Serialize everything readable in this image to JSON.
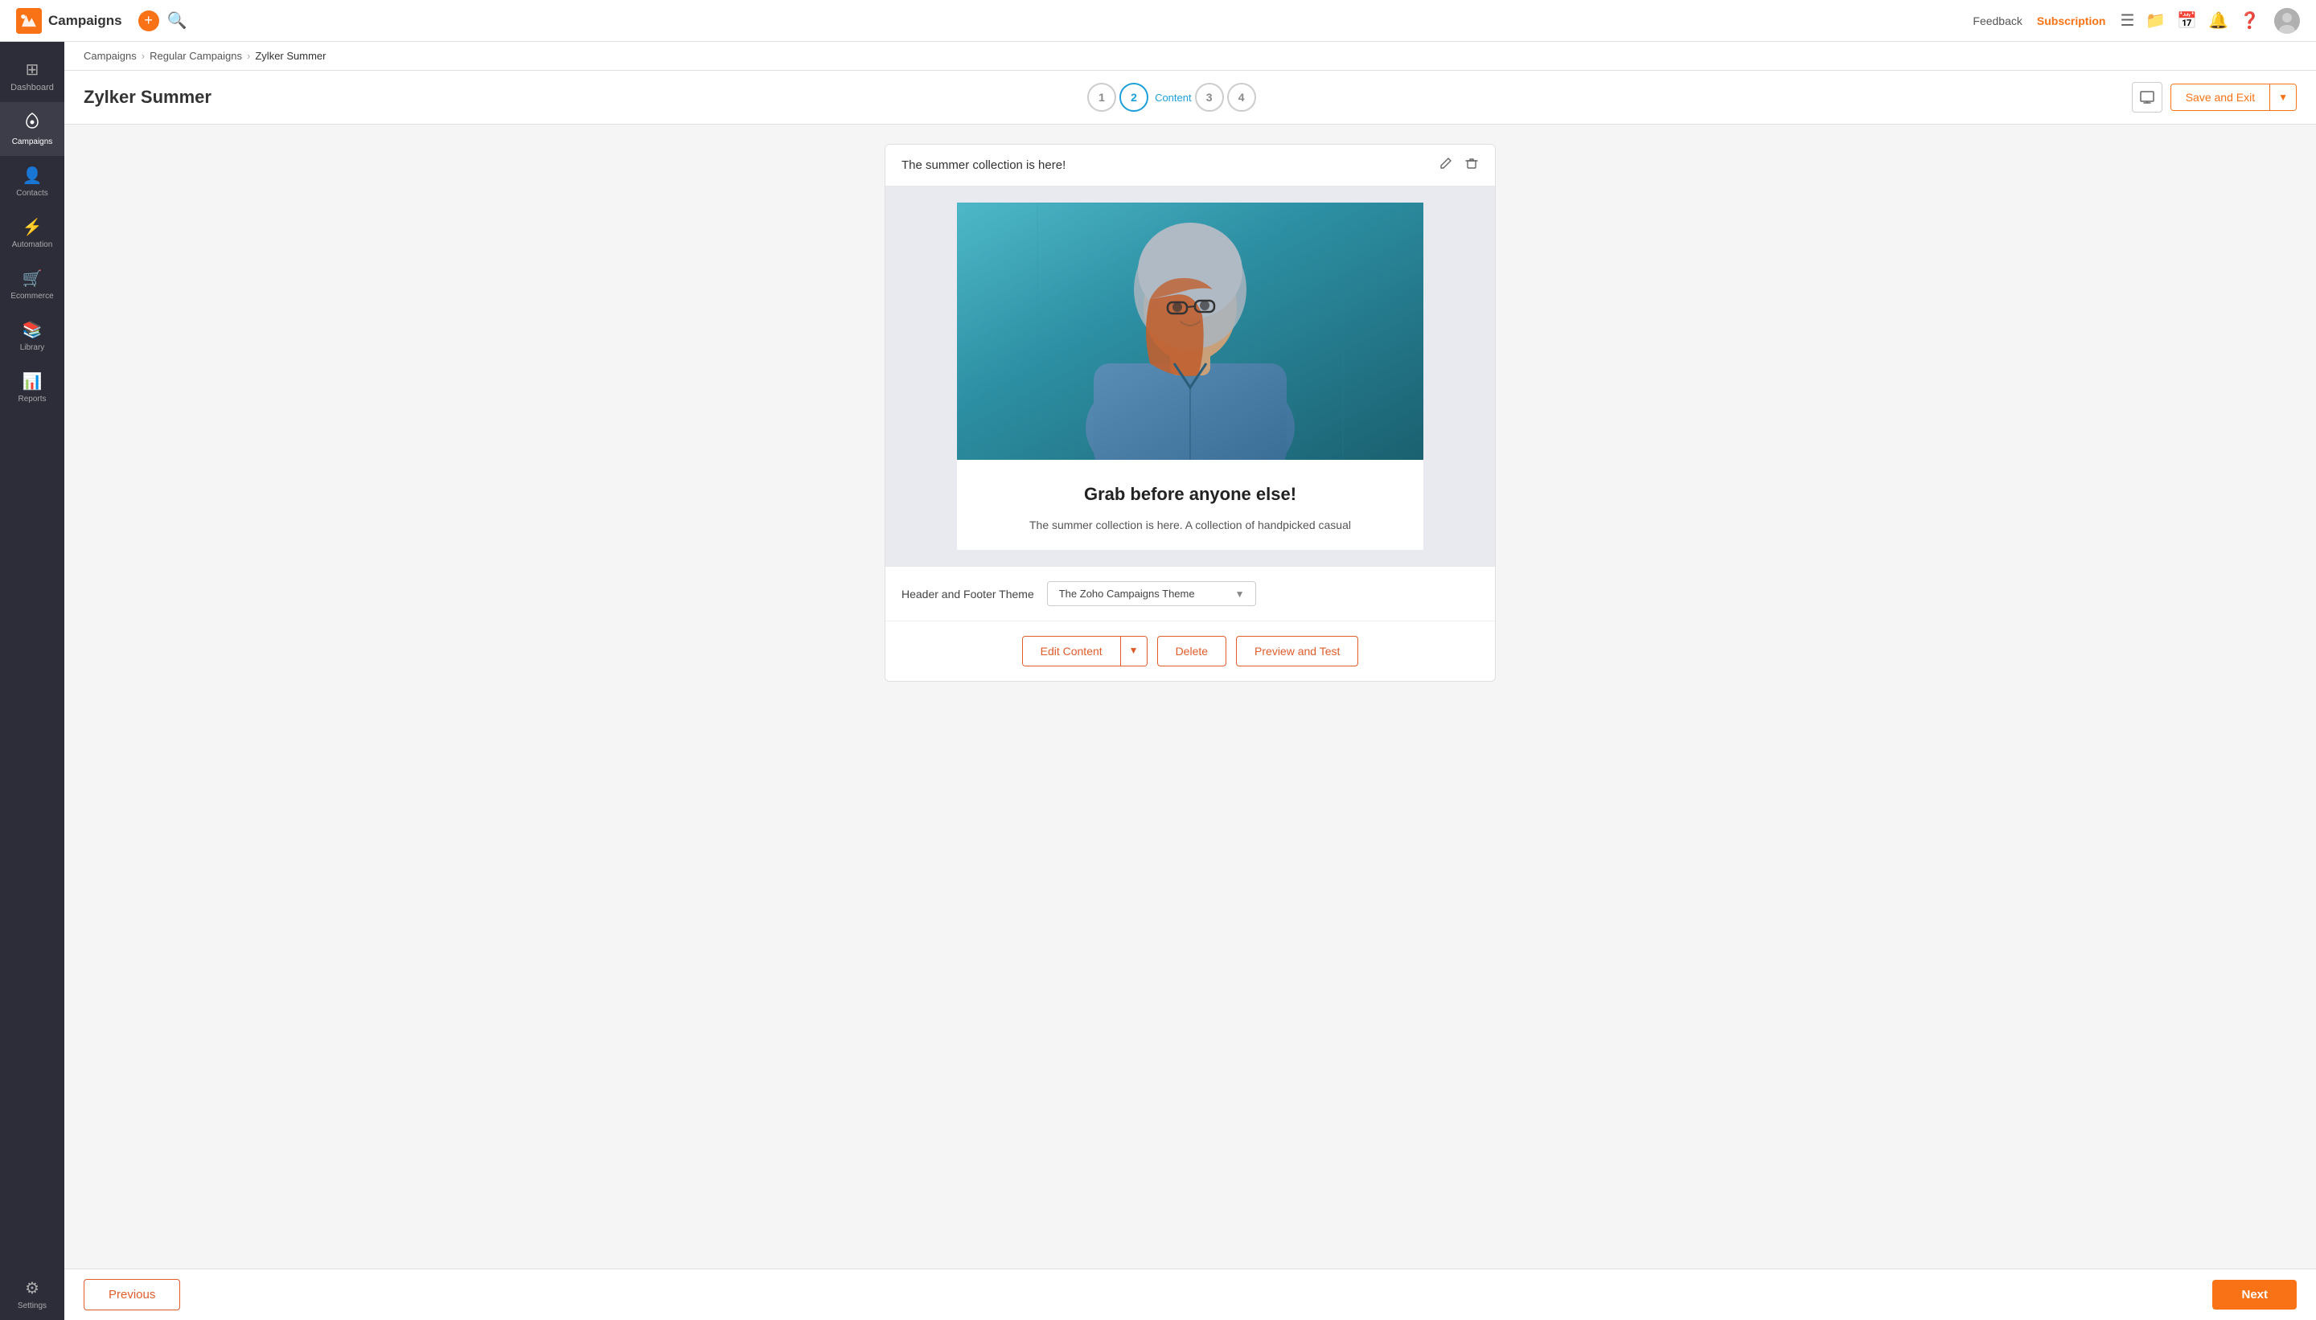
{
  "app": {
    "name": "Campaigns",
    "plus_label": "+",
    "search_label": "🔍"
  },
  "topnav": {
    "feedback": "Feedback",
    "subscription": "Subscription"
  },
  "sidebar": {
    "items": [
      {
        "id": "dashboard",
        "label": "Dashboard",
        "icon": "⊞"
      },
      {
        "id": "campaigns",
        "label": "Campaigns",
        "icon": "📣",
        "active": true
      },
      {
        "id": "contacts",
        "label": "Contacts",
        "icon": "👤"
      },
      {
        "id": "automation",
        "label": "Automation",
        "icon": "⚙"
      },
      {
        "id": "ecommerce",
        "label": "Ecommerce",
        "icon": "🛒"
      },
      {
        "id": "library",
        "label": "Library",
        "icon": "📚"
      },
      {
        "id": "reports",
        "label": "Reports",
        "icon": "📊"
      },
      {
        "id": "settings",
        "label": "Settings",
        "icon": "⚙"
      }
    ]
  },
  "breadcrumb": {
    "items": [
      {
        "label": "Campaigns",
        "link": true
      },
      {
        "label": "Regular Campaigns",
        "link": true
      },
      {
        "label": "Zylker Summer",
        "link": false
      }
    ]
  },
  "campaign": {
    "title": "Zylker Summer"
  },
  "steps": [
    {
      "number": "1",
      "label": "",
      "active": false
    },
    {
      "number": "2",
      "label": "Content",
      "active": true
    },
    {
      "number": "3",
      "label": "",
      "active": false
    },
    {
      "number": "4",
      "label": "",
      "active": false
    }
  ],
  "header_actions": {
    "preview_icon": "📧",
    "save_exit": "Save and Exit",
    "save_exit_arrow": "▼"
  },
  "email_card": {
    "subject": "The summer collection is here!",
    "edit_icon": "✏",
    "delete_icon": "🗑",
    "headline": "Grab before anyone else!",
    "body_text": "The summer collection is here. A collection of handpicked casual"
  },
  "footer": {
    "label": "Header and Footer Theme",
    "theme_selected": "The Zoho Campaigns Theme",
    "chevron": "▼"
  },
  "action_buttons": {
    "edit_content": "Edit Content",
    "edit_arrow": "▼",
    "delete": "Delete",
    "preview_test": "Preview and Test"
  },
  "bottom_nav": {
    "previous": "Previous",
    "next": "Next"
  }
}
